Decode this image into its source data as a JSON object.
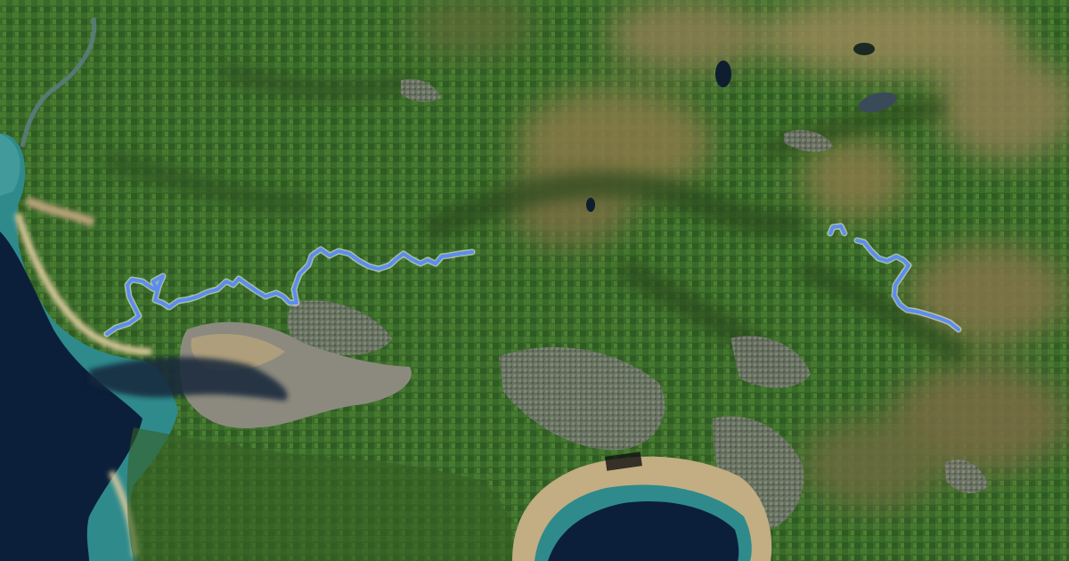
{
  "map": {
    "view": "satellite",
    "labels": [],
    "route": {
      "color": "#5b8def",
      "outline_color": "#ffffff",
      "segment_count": 2
    },
    "palette": {
      "sea_deep": "#0b1f3a",
      "sea_shallow": "#2f8a8c",
      "sand": "#b8a27a",
      "mudflat": "#8c8a7e",
      "farmland": "#3c6b2a",
      "moorland": "#8a7a4a",
      "urban": "#7d8078"
    }
  }
}
